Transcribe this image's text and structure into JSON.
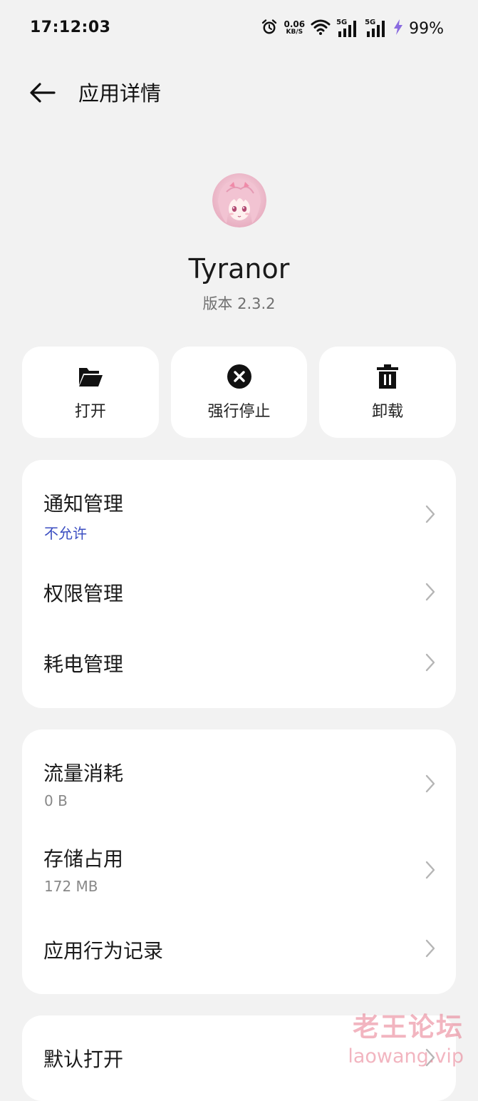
{
  "status_bar": {
    "time": "17:12:03",
    "net_speed_value": "0.06",
    "net_speed_unit": "KB/S",
    "sim1_tag": "5G",
    "sim2_tag": "5G",
    "battery": "99%",
    "icons": [
      "alarm-icon",
      "wifi-icon",
      "signal-icon",
      "signal-icon",
      "charging-icon"
    ]
  },
  "header": {
    "title": "应用详情"
  },
  "app": {
    "name": "Tyranor",
    "version": "版本 2.3.2"
  },
  "actions": [
    {
      "label": "打开",
      "icon": "folder-open-icon"
    },
    {
      "label": "强行停止",
      "icon": "close-circle-icon"
    },
    {
      "label": "卸载",
      "icon": "trash-icon"
    }
  ],
  "card1": {
    "items": [
      {
        "title": "通知管理",
        "sub": "不允许"
      },
      {
        "title": "权限管理"
      },
      {
        "title": "耗电管理"
      }
    ]
  },
  "card2": {
    "items": [
      {
        "title": "流量消耗",
        "sub": "0 B"
      },
      {
        "title": "存储占用",
        "sub": "172 MB"
      },
      {
        "title": "应用行为记录"
      }
    ]
  },
  "card3": {
    "items": [
      {
        "title": "默认打开"
      }
    ]
  },
  "watermark": {
    "cn": "老王论坛",
    "url": "laowang.vip"
  },
  "colors": {
    "background": "#f2f2f2",
    "card": "#ffffff",
    "accent_blue": "#3b4ec1",
    "watermark_pink": "#e8788c"
  }
}
